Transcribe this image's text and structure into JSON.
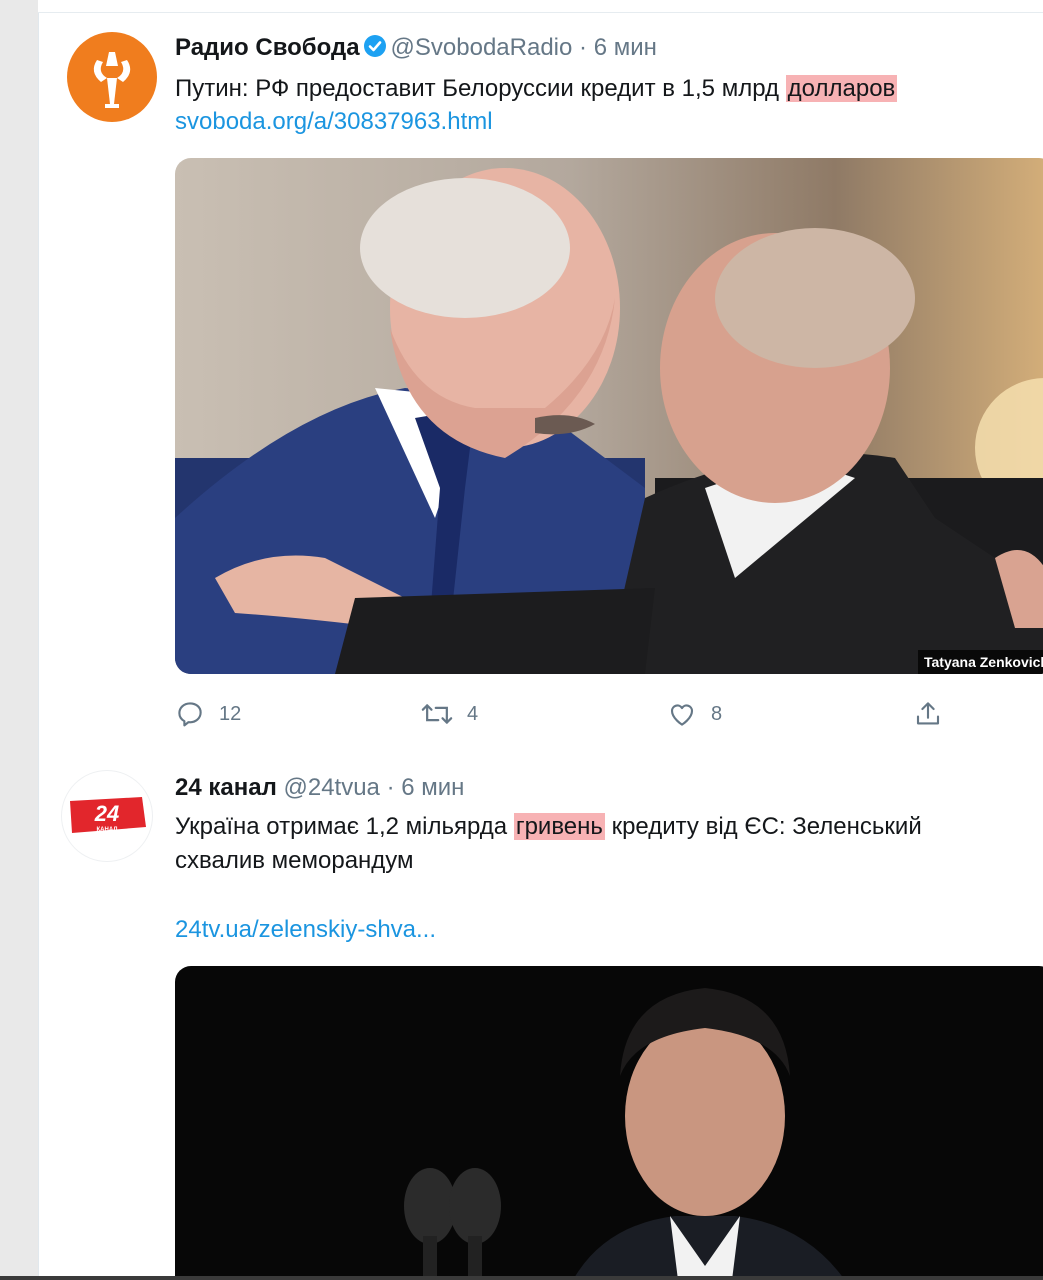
{
  "tweets": [
    {
      "author_name": "Радио Свобода",
      "handle": "@SvobodaRadio",
      "time": "6 мин",
      "text_before": "Путин: РФ предоставит Белоруссии кредит в 1,5 млрд ",
      "text_highlight": "долларов",
      "link": "svoboda.org/a/30837963.html",
      "photo_credit": "Tatyana Zenkovich",
      "avatar_icon": "svoboda-torch-logo",
      "replies": "12",
      "retweets": "4",
      "likes": "8"
    },
    {
      "author_name": "24 канал",
      "handle": "@24tvua",
      "time": "6 мин",
      "text_before": "Україна отримає 1,2 мільярда ",
      "text_highlight": "гривень",
      "text_after": " кредиту від ЄС: Зеленський",
      "text_line2": "схвалив меморандум",
      "link": "24tv.ua/zelenskiy-shva...",
      "avatar_logo_text": "24",
      "avatar_logo_sub": "КАНАЛ"
    }
  ],
  "separator": "·",
  "colors": {
    "link": "#1b95e0",
    "highlight": "#f7b2b4",
    "verified": "#1da1f2",
    "svoboda_orange": "#f07d1e",
    "channel24_red": "#e2262c"
  }
}
